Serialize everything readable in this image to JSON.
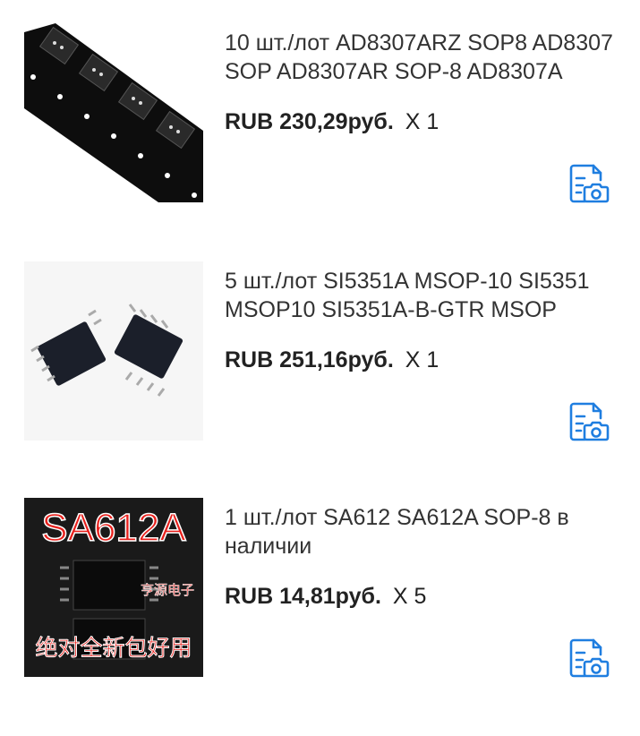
{
  "colors": {
    "accent": "#1f7ee0"
  },
  "items": [
    {
      "title": "10 шт./лот AD8307ARZ SOP8 AD8307 SOP AD8307AR SOP-8 AD8307A",
      "price": "RUB 230,29руб.",
      "qty": "X 1",
      "image_icon": "sop8-chip-tape-image",
      "action_icon": "review-photo-icon"
    },
    {
      "title": "5 шт./лот SI5351A MSOP-10 SI5351 MSOP10 SI5351A-B-GTR MSOP",
      "price": "RUB 251,16руб.",
      "qty": "X 1",
      "image_icon": "msop10-chips-image",
      "action_icon": "review-photo-icon"
    },
    {
      "title": "1 шт./лот SA612 SA612A SOP-8 в наличии",
      "price": "RUB 14,81руб.",
      "qty": "X 5",
      "image_icon": "sa612a-chip-image",
      "image_text": "SA612A",
      "image_caption": "绝对全新包好用",
      "image_watermark": "亨源电子",
      "action_icon": "review-photo-icon"
    }
  ]
}
